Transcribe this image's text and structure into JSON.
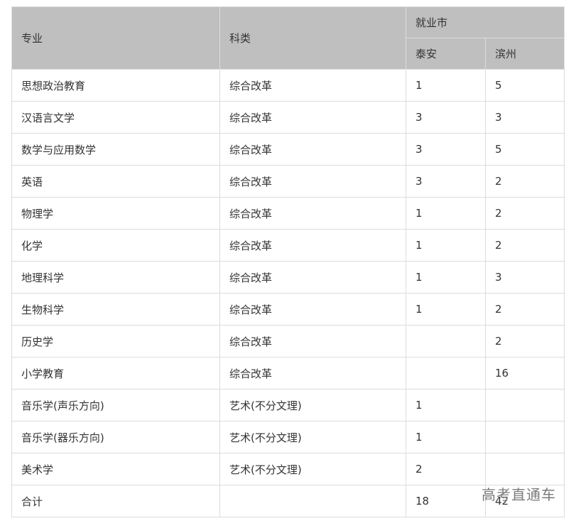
{
  "header": {
    "col_major": "专业",
    "col_category": "科类",
    "col_city_group": "就业市",
    "col_taian": "泰安",
    "col_binzhou": "滨州"
  },
  "rows": [
    {
      "major": "思想政治教育",
      "category": "综合改革",
      "taian": "1",
      "binzhou": "5"
    },
    {
      "major": "汉语言文学",
      "category": "综合改革",
      "taian": "3",
      "binzhou": "3"
    },
    {
      "major": "数学与应用数学",
      "category": "综合改革",
      "taian": "3",
      "binzhou": "5"
    },
    {
      "major": "英语",
      "category": "综合改革",
      "taian": "3",
      "binzhou": "2"
    },
    {
      "major": "物理学",
      "category": "综合改革",
      "taian": "1",
      "binzhou": "2"
    },
    {
      "major": "化学",
      "category": "综合改革",
      "taian": "1",
      "binzhou": "2"
    },
    {
      "major": "地理科学",
      "category": "综合改革",
      "taian": "1",
      "binzhou": "3"
    },
    {
      "major": "生物科学",
      "category": "综合改革",
      "taian": "1",
      "binzhou": "2"
    },
    {
      "major": "历史学",
      "category": "综合改革",
      "taian": "",
      "binzhou": "2"
    },
    {
      "major": "小学教育",
      "category": "综合改革",
      "taian": "",
      "binzhou": "16"
    },
    {
      "major": "音乐学(声乐方向)",
      "category": "艺术(不分文理)",
      "taian": "1",
      "binzhou": ""
    },
    {
      "major": "音乐学(器乐方向)",
      "category": "艺术(不分文理)",
      "taian": "1",
      "binzhou": ""
    },
    {
      "major": "美术学",
      "category": "艺术(不分文理)",
      "taian": "2",
      "binzhou": ""
    },
    {
      "major": "合计",
      "category": "",
      "taian": "18",
      "binzhou": "42"
    }
  ],
  "watermark": "高考直通车"
}
